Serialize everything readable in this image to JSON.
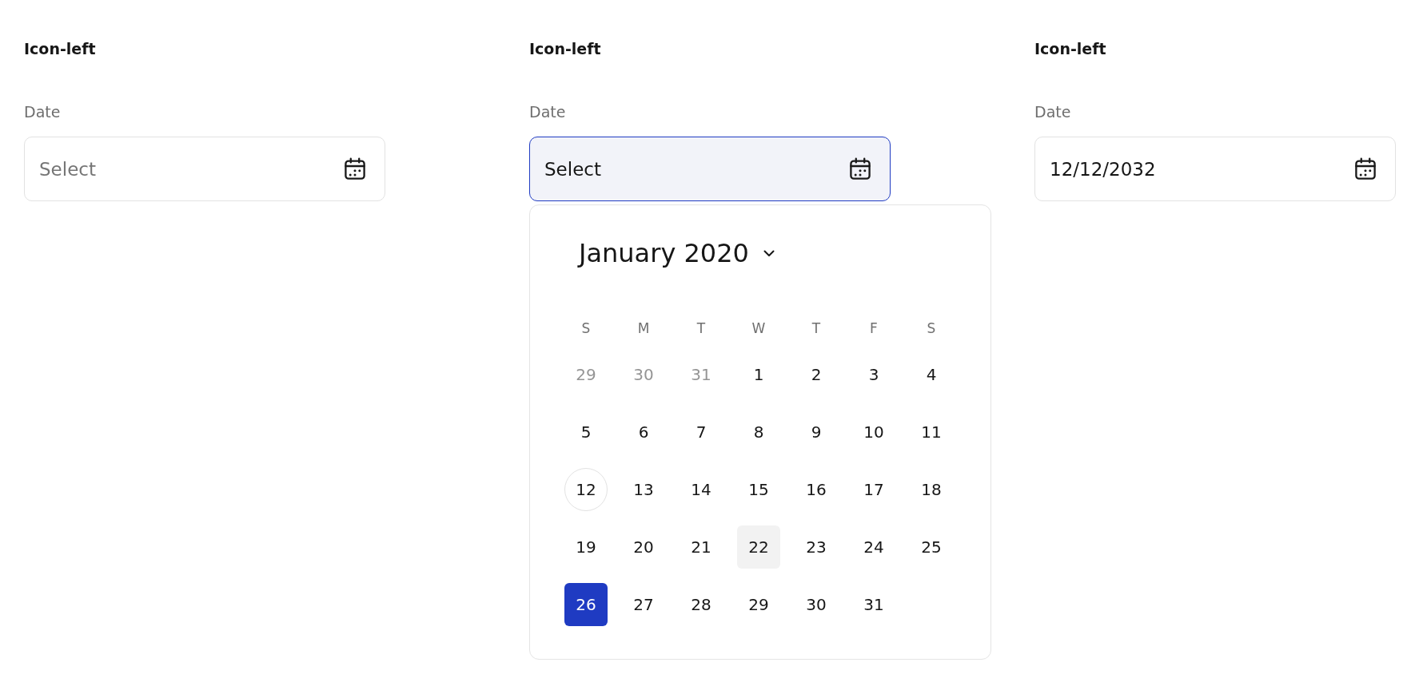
{
  "examples": [
    {
      "heading": "Icon-left",
      "label": "Date",
      "placeholder": "Select",
      "focused": false
    },
    {
      "heading": "Icon-left",
      "label": "Date",
      "placeholder": "Select",
      "focused": true,
      "calendar": {
        "month": "January 2020",
        "weekdays": [
          "S",
          "M",
          "T",
          "W",
          "T",
          "F",
          "S"
        ],
        "days": [
          {
            "label": "29",
            "other_month": true,
            "today": false,
            "hovered": false,
            "selected": false
          },
          {
            "label": "30",
            "other_month": true,
            "today": false,
            "hovered": false,
            "selected": false
          },
          {
            "label": "31",
            "other_month": true,
            "today": false,
            "hovered": false,
            "selected": false
          },
          {
            "label": "1",
            "other_month": false,
            "today": false,
            "hovered": false,
            "selected": false
          },
          {
            "label": "2",
            "other_month": false,
            "today": false,
            "hovered": false,
            "selected": false
          },
          {
            "label": "3",
            "other_month": false,
            "today": false,
            "hovered": false,
            "selected": false
          },
          {
            "label": "4",
            "other_month": false,
            "today": false,
            "hovered": false,
            "selected": false
          },
          {
            "label": "5",
            "other_month": false,
            "today": false,
            "hovered": false,
            "selected": false
          },
          {
            "label": "6",
            "other_month": false,
            "today": false,
            "hovered": false,
            "selected": false
          },
          {
            "label": "7",
            "other_month": false,
            "today": false,
            "hovered": false,
            "selected": false
          },
          {
            "label": "8",
            "other_month": false,
            "today": false,
            "hovered": false,
            "selected": false
          },
          {
            "label": "9",
            "other_month": false,
            "today": false,
            "hovered": false,
            "selected": false
          },
          {
            "label": "10",
            "other_month": false,
            "today": false,
            "hovered": false,
            "selected": false
          },
          {
            "label": "11",
            "other_month": false,
            "today": false,
            "hovered": false,
            "selected": false
          },
          {
            "label": "12",
            "other_month": false,
            "today": true,
            "hovered": false,
            "selected": false
          },
          {
            "label": "13",
            "other_month": false,
            "today": false,
            "hovered": false,
            "selected": false
          },
          {
            "label": "14",
            "other_month": false,
            "today": false,
            "hovered": false,
            "selected": false
          },
          {
            "label": "15",
            "other_month": false,
            "today": false,
            "hovered": false,
            "selected": false
          },
          {
            "label": "16",
            "other_month": false,
            "today": false,
            "hovered": false,
            "selected": false
          },
          {
            "label": "17",
            "other_month": false,
            "today": false,
            "hovered": false,
            "selected": false
          },
          {
            "label": "18",
            "other_month": false,
            "today": false,
            "hovered": false,
            "selected": false
          },
          {
            "label": "19",
            "other_month": false,
            "today": false,
            "hovered": false,
            "selected": false
          },
          {
            "label": "20",
            "other_month": false,
            "today": false,
            "hovered": false,
            "selected": false
          },
          {
            "label": "21",
            "other_month": false,
            "today": false,
            "hovered": false,
            "selected": false
          },
          {
            "label": "22",
            "other_month": false,
            "today": false,
            "hovered": true,
            "selected": false
          },
          {
            "label": "23",
            "other_month": false,
            "today": false,
            "hovered": false,
            "selected": false
          },
          {
            "label": "24",
            "other_month": false,
            "today": false,
            "hovered": false,
            "selected": false
          },
          {
            "label": "25",
            "other_month": false,
            "today": false,
            "hovered": false,
            "selected": false
          },
          {
            "label": "26",
            "other_month": false,
            "today": false,
            "hovered": false,
            "selected": true
          },
          {
            "label": "27",
            "other_month": false,
            "today": false,
            "hovered": false,
            "selected": false
          },
          {
            "label": "28",
            "other_month": false,
            "today": false,
            "hovered": false,
            "selected": false
          },
          {
            "label": "29",
            "other_month": false,
            "today": false,
            "hovered": false,
            "selected": false
          },
          {
            "label": "30",
            "other_month": false,
            "today": false,
            "hovered": false,
            "selected": false
          },
          {
            "label": "31",
            "other_month": false,
            "today": false,
            "hovered": false,
            "selected": false
          }
        ]
      }
    },
    {
      "heading": "Icon-left",
      "label": "Date",
      "value": "12/12/2032",
      "focused": false
    }
  ]
}
